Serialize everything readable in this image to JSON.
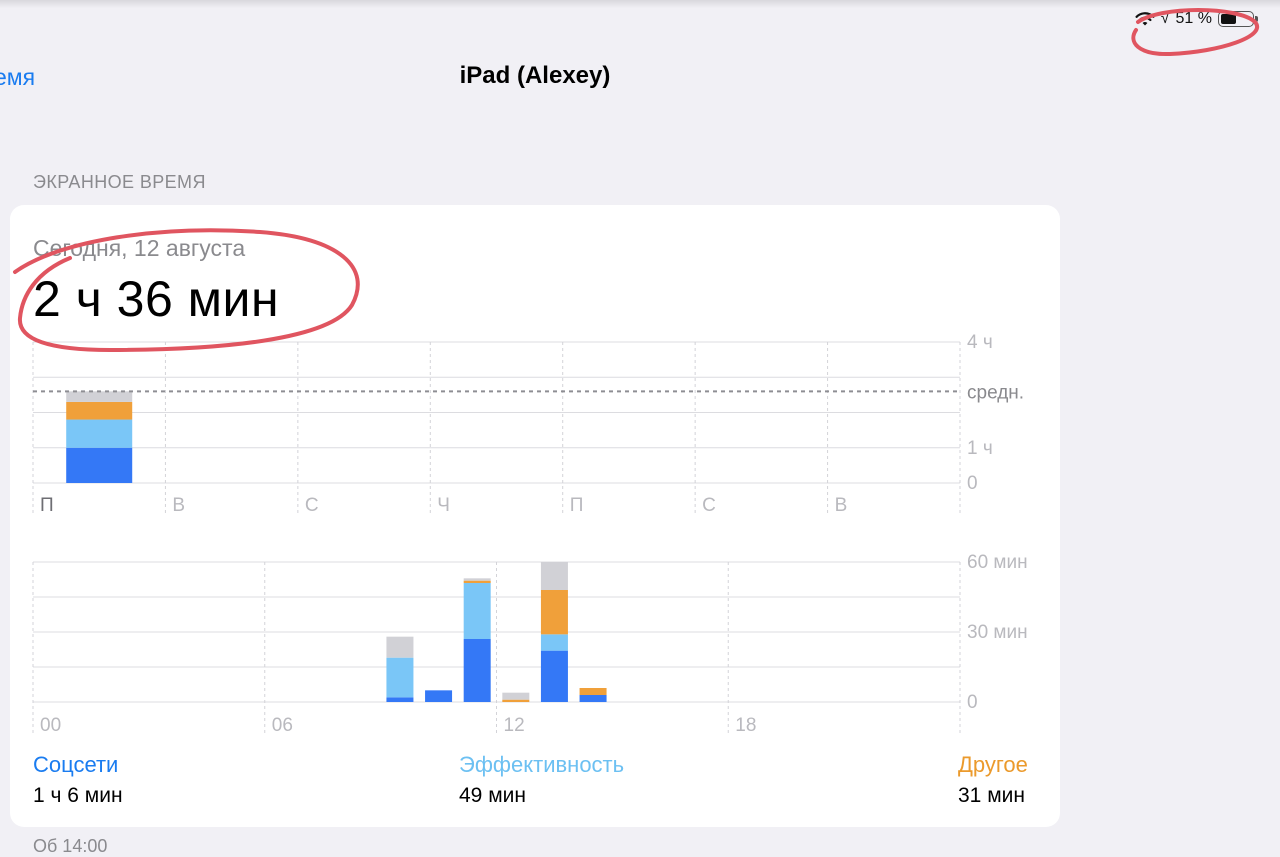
{
  "status": {
    "signal": "√",
    "battery_percent": "51 %",
    "battery_level": 0.51
  },
  "nav": {
    "back_label": "емя",
    "title": "iPad (Alexey)"
  },
  "section": {
    "header": "ЭКРАННОЕ ВРЕМЯ",
    "date": "Сегодня, 12 августа",
    "total": "2 ч 36 мин"
  },
  "colors": {
    "social": "#3478f6",
    "productivity": "#7ac6f7",
    "other": "#f0a03a",
    "rest": "#d1d1d6",
    "accent": "#1a7cf0",
    "annotation": "#e05560"
  },
  "chart_data": [
    {
      "type": "bar",
      "stacked": true,
      "categories": [
        "П",
        "В",
        "С",
        "Ч",
        "П",
        "С",
        "В"
      ],
      "y_tick_labels": [
        "4 ч",
        "средн.",
        "1 ч",
        "0"
      ],
      "ylim": [
        0,
        4
      ],
      "average_hours": 2.6,
      "series": [
        {
          "key": "social",
          "values": [
            1.0,
            0,
            0,
            0,
            0,
            0,
            0
          ]
        },
        {
          "key": "productivity",
          "values": [
            0.8,
            0,
            0,
            0,
            0,
            0,
            0
          ]
        },
        {
          "key": "other",
          "values": [
            0.5,
            0,
            0,
            0,
            0,
            0,
            0
          ]
        },
        {
          "key": "rest",
          "values": [
            0.3,
            0,
            0,
            0,
            0,
            0,
            0
          ]
        }
      ]
    },
    {
      "type": "bar",
      "stacked": true,
      "x_tick_labels": [
        "00",
        "06",
        "12",
        "18"
      ],
      "y_tick_labels": [
        "60 мин",
        "30 мин",
        "0"
      ],
      "ylim": [
        0,
        60
      ],
      "hours": [
        9,
        10,
        11,
        12,
        13,
        14
      ],
      "series": [
        {
          "key": "social",
          "values": [
            2,
            5,
            27,
            0,
            22,
            3
          ]
        },
        {
          "key": "productivity",
          "values": [
            17,
            0,
            24,
            0,
            7,
            0
          ]
        },
        {
          "key": "other",
          "values": [
            0,
            0,
            1,
            1,
            19,
            3
          ]
        },
        {
          "key": "rest",
          "values": [
            9,
            0,
            1,
            3,
            12,
            0
          ]
        }
      ]
    }
  ],
  "legend": [
    {
      "label": "Соцсети",
      "value": "1 ч 6 мин",
      "color": "#3478f6"
    },
    {
      "label": "Эффективность",
      "value": "49 мин",
      "color": "#7ac6f7"
    },
    {
      "label": "Другое",
      "value": "31 мин",
      "color": "#f0a03a"
    }
  ],
  "footer": {
    "partial_text": "Об                 14:00"
  }
}
